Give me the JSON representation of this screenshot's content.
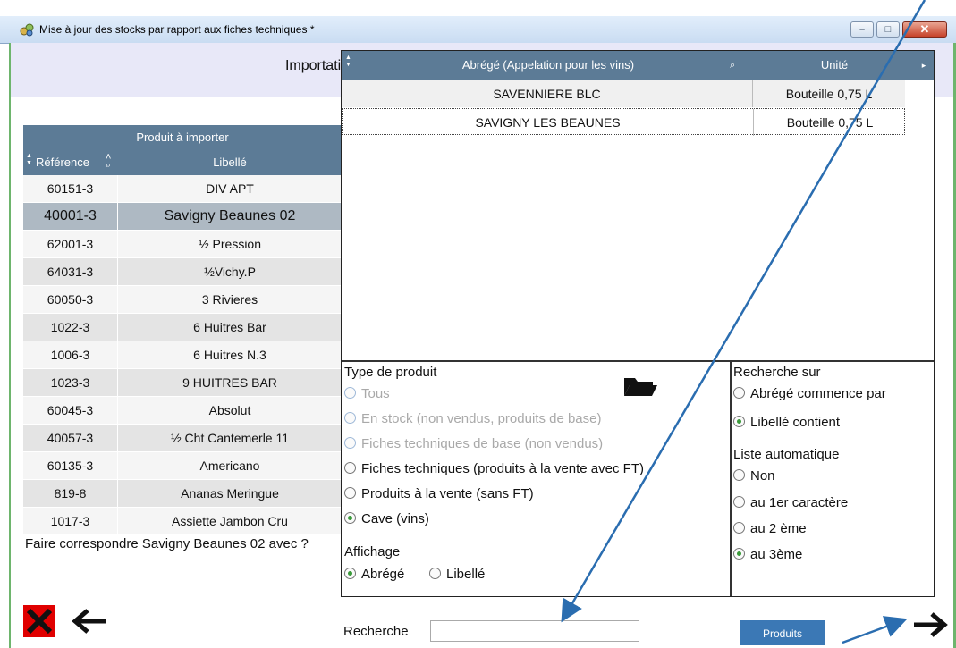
{
  "window": {
    "title": "Mise à jour des stocks par rapport aux fiches techniques *",
    "min_glyph": "–",
    "max_glyph": "□",
    "close_glyph": "✕"
  },
  "header": {
    "title": "Importation"
  },
  "left_table": {
    "group_header": "Produit à importer",
    "columns": [
      "Référence",
      "Libellé"
    ],
    "rows": [
      {
        "ref": "60151-3",
        "label": "DIV APT"
      },
      {
        "ref": "40001-3",
        "label": "Savigny Beaunes 02",
        "selected": true
      },
      {
        "ref": "62001-3",
        "label": "½ Pression"
      },
      {
        "ref": "64031-3",
        "label": "½Vichy.P"
      },
      {
        "ref": "60050-3",
        "label": "3 Rivieres"
      },
      {
        "ref": "1022-3",
        "label": "6 Huitres Bar"
      },
      {
        "ref": "1006-3",
        "label": "6 Huitres N.3"
      },
      {
        "ref": "1023-3",
        "label": "9 HUITRES BAR"
      },
      {
        "ref": "60045-3",
        "label": "Absolut"
      },
      {
        "ref": "40057-3",
        "label": "½ Cht Cantemerle 11"
      },
      {
        "ref": "60135-3",
        "label": "Americano"
      },
      {
        "ref": "819-8",
        "label": "Ananas Meringue"
      },
      {
        "ref": "1017-3",
        "label": "Assiette Jambon Cru"
      }
    ]
  },
  "question": "Faire correspondre Savigny Beaunes 02 avec ?",
  "popup": {
    "columns": [
      "Abrégé (Appelation pour les vins)",
      "Unité"
    ],
    "rows": [
      {
        "name": "SAVENNIERE BLC",
        "unit": "Bouteille 0,75 L"
      },
      {
        "name": "SAVIGNY LES BEAUNES",
        "unit": "Bouteille 0,75 L",
        "focused": true
      }
    ]
  },
  "type_produit": {
    "title": "Type de produit",
    "options": [
      {
        "label": "Tous",
        "disabled": true,
        "checked": false
      },
      {
        "label": "En stock (non vendus, produits de base)",
        "disabled": true,
        "checked": false
      },
      {
        "label": "Fiches techniques de base (non vendus)",
        "disabled": true,
        "checked": false
      },
      {
        "label": "Fiches techniques (produits à la vente avec FT)",
        "disabled": false,
        "checked": false
      },
      {
        "label": "Produits à la vente (sans FT)",
        "disabled": false,
        "checked": false
      },
      {
        "label": "Cave (vins)",
        "disabled": false,
        "checked": true
      }
    ]
  },
  "affichage": {
    "title": "Affichage",
    "options": [
      {
        "label": "Abrégé",
        "checked": true
      },
      {
        "label": "Libellé",
        "checked": false
      }
    ]
  },
  "recherche_sur": {
    "title": "Recherche sur",
    "options": [
      {
        "label": "Abrégé commence par",
        "checked": false
      },
      {
        "label": "Libellé contient",
        "checked": true
      }
    ]
  },
  "liste_auto": {
    "title": "Liste automatique",
    "options": [
      {
        "label": "Non",
        "checked": false
      },
      {
        "label": "au 1er caractère",
        "checked": false
      },
      {
        "label": "au 2 ème",
        "checked": false
      },
      {
        "label": "au 3ème",
        "checked": true
      }
    ]
  },
  "bottom": {
    "search_label": "Recherche",
    "search_value": "",
    "produits_button": "Produits"
  },
  "colors": {
    "header_blue": "#5c7b96",
    "selected_row": "#aeb9c3",
    "button_blue": "#3b78b5",
    "cancel_red": "#e00000",
    "annotation_arrow": "#2a6db0"
  },
  "icons": [
    "app-icon",
    "folder-icon",
    "cancel-x-icon",
    "back-arrow-icon",
    "forward-arrow-icon",
    "search-lens-icon"
  ]
}
